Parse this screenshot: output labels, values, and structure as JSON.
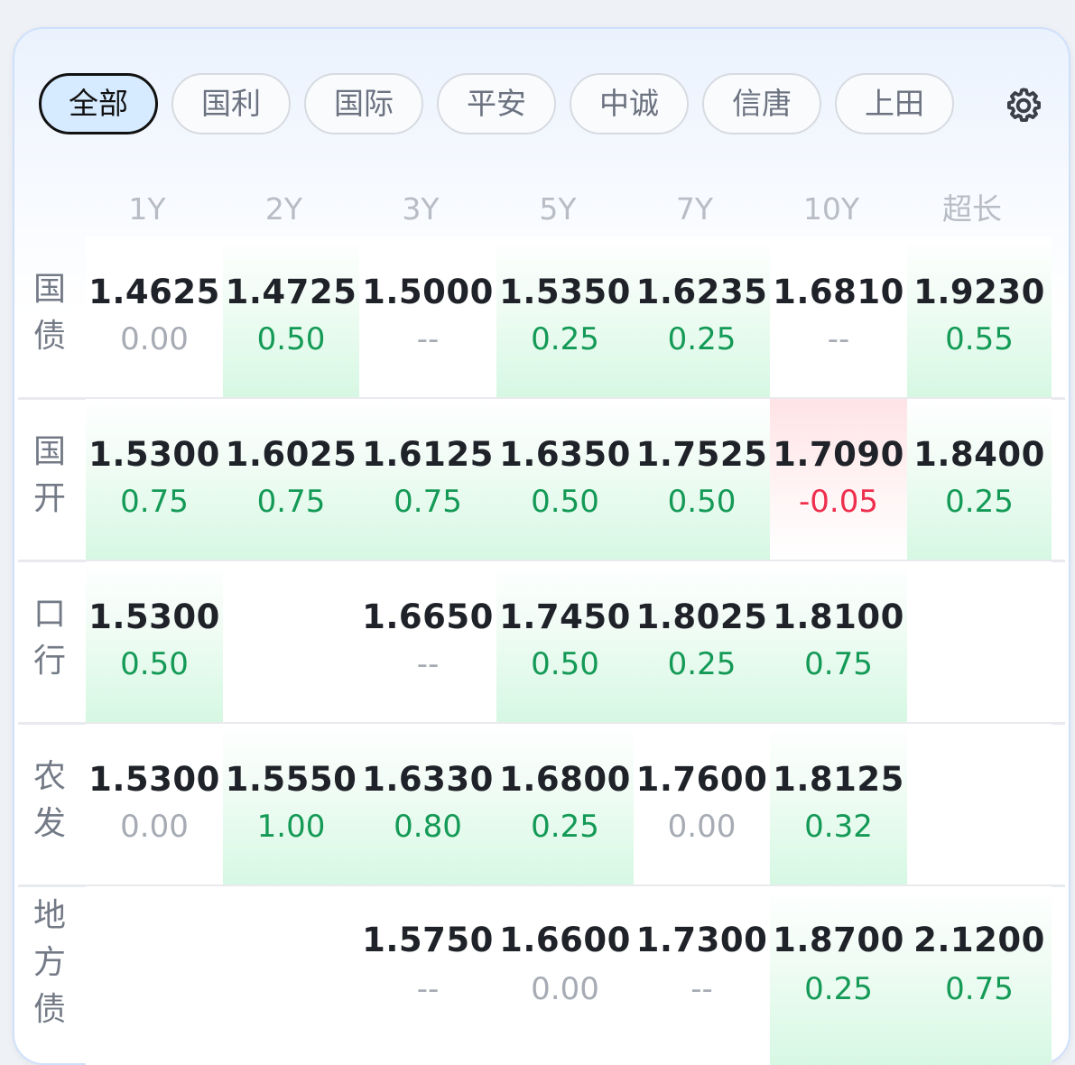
{
  "tabs": [
    {
      "label": "全部",
      "active": true
    },
    {
      "label": "国利",
      "active": false
    },
    {
      "label": "国际",
      "active": false
    },
    {
      "label": "平安",
      "active": false
    },
    {
      "label": "中诚",
      "active": false
    },
    {
      "label": "信唐",
      "active": false
    },
    {
      "label": "上田",
      "active": false
    }
  ],
  "settings_icon": "gear-icon",
  "columns": [
    "1Y",
    "2Y",
    "3Y",
    "5Y",
    "7Y",
    "10Y",
    "超长"
  ],
  "rows": [
    {
      "label": [
        "国",
        "债"
      ],
      "cells": [
        {
          "value": "1.4625",
          "change": "0.00",
          "trend": "flat"
        },
        {
          "value": "1.4725",
          "change": "0.50",
          "trend": "up"
        },
        {
          "value": "1.5000",
          "change": "--",
          "trend": "flat"
        },
        {
          "value": "1.5350",
          "change": "0.25",
          "trend": "up"
        },
        {
          "value": "1.6235",
          "change": "0.25",
          "trend": "up"
        },
        {
          "value": "1.6810",
          "change": "--",
          "trend": "flat"
        },
        {
          "value": "1.9230",
          "change": "0.55",
          "trend": "up"
        }
      ]
    },
    {
      "label": [
        "国",
        "开"
      ],
      "cells": [
        {
          "value": "1.5300",
          "change": "0.75",
          "trend": "up"
        },
        {
          "value": "1.6025",
          "change": "0.75",
          "trend": "up"
        },
        {
          "value": "1.6125",
          "change": "0.75",
          "trend": "up"
        },
        {
          "value": "1.6350",
          "change": "0.50",
          "trend": "up"
        },
        {
          "value": "1.7525",
          "change": "0.50",
          "trend": "up"
        },
        {
          "value": "1.7090",
          "change": "-0.05",
          "trend": "down"
        },
        {
          "value": "1.8400",
          "change": "0.25",
          "trend": "up"
        }
      ]
    },
    {
      "label": [
        "口",
        "行"
      ],
      "cells": [
        {
          "value": "1.5300",
          "change": "0.50",
          "trend": "up"
        },
        {
          "value": "",
          "change": "",
          "trend": "empty"
        },
        {
          "value": "1.6650",
          "change": "--",
          "trend": "flat"
        },
        {
          "value": "1.7450",
          "change": "0.50",
          "trend": "up"
        },
        {
          "value": "1.8025",
          "change": "0.25",
          "trend": "up"
        },
        {
          "value": "1.8100",
          "change": "0.75",
          "trend": "up"
        },
        {
          "value": "",
          "change": "",
          "trend": "empty"
        }
      ]
    },
    {
      "label": [
        "农",
        "发"
      ],
      "cells": [
        {
          "value": "1.5300",
          "change": "0.00",
          "trend": "flat"
        },
        {
          "value": "1.5550",
          "change": "1.00",
          "trend": "up"
        },
        {
          "value": "1.6330",
          "change": "0.80",
          "trend": "up"
        },
        {
          "value": "1.6800",
          "change": "0.25",
          "trend": "up"
        },
        {
          "value": "1.7600",
          "change": "0.00",
          "trend": "flat"
        },
        {
          "value": "1.8125",
          "change": "0.32",
          "trend": "up"
        },
        {
          "value": "",
          "change": "",
          "trend": "empty"
        }
      ]
    },
    {
      "label": [
        "地",
        "方",
        "债"
      ],
      "cells": [
        {
          "value": "",
          "change": "",
          "trend": "empty"
        },
        {
          "value": "",
          "change": "",
          "trend": "empty"
        },
        {
          "value": "1.5750",
          "change": "--",
          "trend": "flat"
        },
        {
          "value": "1.6600",
          "change": "0.00",
          "trend": "flat"
        },
        {
          "value": "1.7300",
          "change": "--",
          "trend": "flat"
        },
        {
          "value": "1.8700",
          "change": "0.25",
          "trend": "up"
        },
        {
          "value": "2.1200",
          "change": "0.75",
          "trend": "up"
        }
      ]
    }
  ],
  "colors": {
    "up_text": "#149a56",
    "down_text": "#ee2f4d",
    "flat_text": "#a6abb4",
    "active_tab_bg": "#d6ebff"
  }
}
